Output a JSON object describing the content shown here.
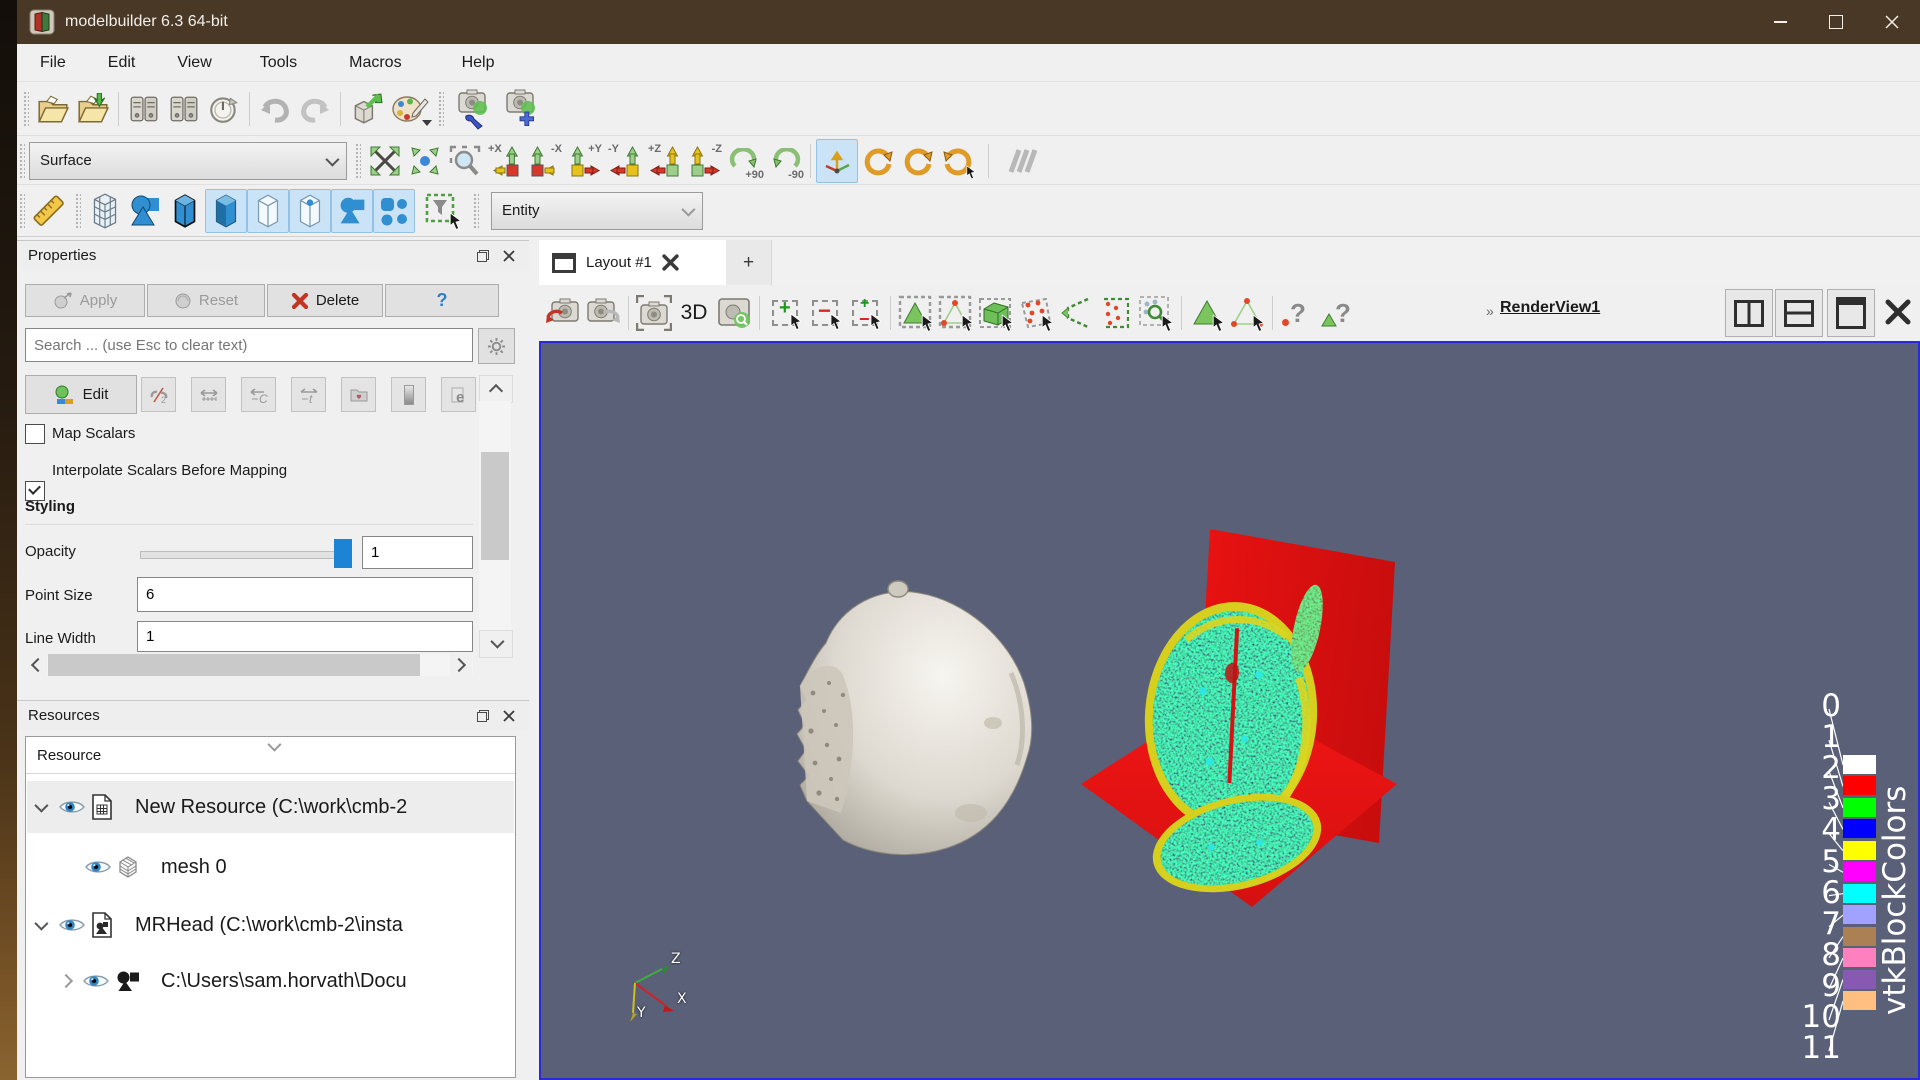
{
  "window": {
    "title": "modelbuilder 6.3 64-bit"
  },
  "menu": {
    "items": [
      "File",
      "Edit",
      "View",
      "Tools",
      "Macros",
      "Help"
    ]
  },
  "toolbars": {
    "representation": "Surface",
    "entity": "Entity",
    "camera_buttons": {
      "plus_x": "+X",
      "minus_x": "-X",
      "plus_y": "+Y",
      "minus_y": "-Y",
      "plus_z": "+Z",
      "minus_z": "-Z",
      "rot_cw": "+90",
      "rot_ccw": "-90"
    }
  },
  "properties_panel": {
    "title": "Properties",
    "apply": "Apply",
    "reset": "Reset",
    "delete": "Delete",
    "help": "?",
    "search_placeholder": "Search ... (use Esc to clear text)",
    "edit": "Edit",
    "map_scalars": {
      "label": "Map Scalars",
      "checked": false
    },
    "interpolate": {
      "label": "Interpolate Scalars Before Mapping",
      "checked": true
    },
    "styling_heading": "Styling",
    "opacity": {
      "label": "Opacity",
      "value": "1"
    },
    "point_size": {
      "label": "Point Size",
      "value": "6"
    },
    "line_width": {
      "label": "Line Width",
      "value": "1"
    }
  },
  "resources_panel": {
    "title": "Resources",
    "column_header": "Resource",
    "rows": [
      {
        "label": "New Resource (C:\\work\\cmb-2",
        "selected": true
      },
      {
        "label": "mesh 0",
        "selected": false
      },
      {
        "label": "MRHead (C:\\work\\cmb-2\\insta",
        "selected": false
      },
      {
        "label": "C:\\Users\\sam.horvath\\Docu",
        "selected": false
      }
    ]
  },
  "layout_tabs": {
    "active": "Layout #1",
    "add": "+"
  },
  "render_toolbar": {
    "mode_3d": "3D",
    "overflow": "»",
    "view_name": "RenderView1"
  },
  "render_view": {
    "legend": {
      "title": "vtkBlockColors",
      "entries": [
        {
          "label": "0",
          "color": "#ffffff"
        },
        {
          "label": "1",
          "color": "#ff0000"
        },
        {
          "label": "2",
          "color": "#00ff00"
        },
        {
          "label": "3",
          "color": "#0000ff"
        },
        {
          "label": "4",
          "color": "#ffff00"
        },
        {
          "label": "5",
          "color": "#ff00ff"
        },
        {
          "label": "6",
          "color": "#00ffff"
        },
        {
          "label": "7",
          "color": "#a1a1ff"
        },
        {
          "label": "8",
          "color": "#ab8054"
        },
        {
          "label": "9",
          "color": "#ff80bf"
        },
        {
          "label": "10",
          "color": "#8759b3"
        },
        {
          "label": "11",
          "color": "#ffbf80"
        }
      ]
    },
    "axes": {
      "x": "X",
      "y": "Y",
      "z": "Z"
    }
  }
}
